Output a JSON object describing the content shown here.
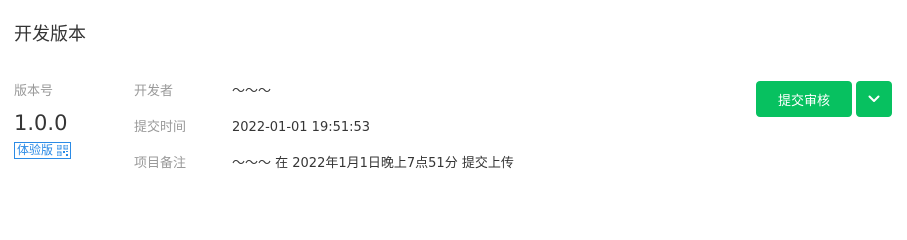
{
  "section": {
    "title": "开发版本"
  },
  "version": {
    "label": "版本号",
    "number": "1.0.0",
    "badge": "体验版"
  },
  "info": {
    "developer_label": "开发者",
    "developer_value": "～～～",
    "submit_time_label": "提交时间",
    "submit_time_value": "2022-01-01 19:51:53",
    "remark_label": "项目备注",
    "remark_value": "～～～ 在 2022年1月1日晚上7点51分 提交上传"
  },
  "actions": {
    "submit_review_label": "提交审核",
    "dropdown_icon": "chevron-down-icon"
  },
  "colors": {
    "primary": "#07c160",
    "badge": "#2b8be6",
    "label": "#9a9a9a",
    "text": "#353535"
  }
}
